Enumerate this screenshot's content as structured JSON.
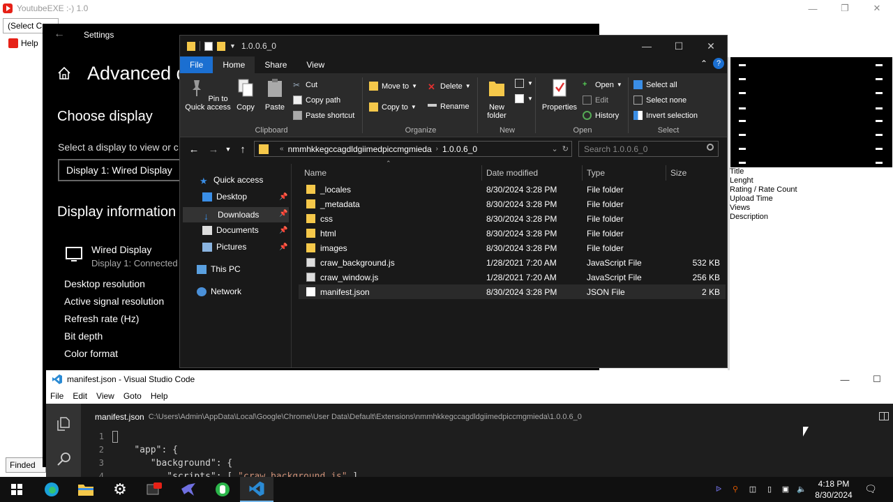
{
  "background_app": {
    "title": "YoutubeEXE  :-)   1.0",
    "select_label": "(Select C",
    "help_label": "Help",
    "find_button": "Finded",
    "properties": [
      "Title",
      "Lenght",
      "Rating / Rate Count",
      "Upload Time",
      "Views",
      "Description"
    ]
  },
  "settings": {
    "window_title": "Settings",
    "page_title": "Advanced d",
    "choose_display_heading": "Choose display",
    "select_prompt": "Select a display to view or c",
    "display_select_value": "Display 1: Wired Display",
    "display_info_heading": "Display information",
    "display_name": "Wired Display",
    "display_sub": "Display 1: Connected t",
    "info_items": [
      "Desktop resolution",
      "Active signal resolution",
      "Refresh rate (Hz)",
      "Bit depth",
      "Color format"
    ]
  },
  "explorer": {
    "title": "1.0.0.6_0",
    "tabs": {
      "file": "File",
      "home": "Home",
      "share": "Share",
      "view": "View"
    },
    "ribbon": {
      "pin_label": "Pin to Quick access",
      "copy": "Copy",
      "paste": "Paste",
      "cut": "Cut",
      "copy_path": "Copy path",
      "paste_shortcut": "Paste shortcut",
      "clipboard_group": "Clipboard",
      "move_to": "Move to",
      "copy_to": "Copy to",
      "delete": "Delete",
      "rename": "Rename",
      "organize_group": "Organize",
      "new_folder": "New folder",
      "new_group": "New",
      "properties": "Properties",
      "open": "Open",
      "edit": "Edit",
      "history": "History",
      "open_group": "Open",
      "select_all": "Select all",
      "select_none": "Select none",
      "invert_selection": "Invert selection",
      "select_group": "Select"
    },
    "path_segments": [
      "nmmhkkegccagdldgiimedpiccmgmieda",
      "1.0.0.6_0"
    ],
    "search_placeholder": "Search 1.0.0.6_0",
    "nav": {
      "quick_access": "Quick access",
      "desktop": "Desktop",
      "downloads": "Downloads",
      "documents": "Documents",
      "pictures": "Pictures",
      "this_pc": "This PC",
      "network": "Network"
    },
    "columns": {
      "name": "Name",
      "date": "Date modified",
      "type": "Type",
      "size": "Size"
    },
    "files": [
      {
        "name": "_locales",
        "date": "8/30/2024 3:28 PM",
        "type": "File folder",
        "size": "",
        "kind": "folder"
      },
      {
        "name": "_metadata",
        "date": "8/30/2024 3:28 PM",
        "type": "File folder",
        "size": "",
        "kind": "folder"
      },
      {
        "name": "css",
        "date": "8/30/2024 3:28 PM",
        "type": "File folder",
        "size": "",
        "kind": "folder"
      },
      {
        "name": "html",
        "date": "8/30/2024 3:28 PM",
        "type": "File folder",
        "size": "",
        "kind": "folder"
      },
      {
        "name": "images",
        "date": "8/30/2024 3:28 PM",
        "type": "File folder",
        "size": "",
        "kind": "folder"
      },
      {
        "name": "craw_background.js",
        "date": "1/28/2021 7:20 AM",
        "type": "JavaScript File",
        "size": "532 KB",
        "kind": "js"
      },
      {
        "name": "craw_window.js",
        "date": "1/28/2021 7:20 AM",
        "type": "JavaScript File",
        "size": "256 KB",
        "kind": "js"
      },
      {
        "name": "manifest.json",
        "date": "8/30/2024 3:28 PM",
        "type": "JSON File",
        "size": "2 KB",
        "kind": "json"
      }
    ]
  },
  "vscode": {
    "title": "manifest.json - Visual Studio Code",
    "menu": [
      "File",
      "Edit",
      "View",
      "Goto",
      "Help"
    ],
    "file_name": "manifest.json",
    "file_path": "C:\\Users\\Admin\\AppData\\Local\\Google\\Chrome\\User Data\\Default\\Extensions\\nmmhkkegccagdldgiimedpiccmgmieda\\1.0.0.6_0",
    "line_numbers": [
      "1",
      "2",
      "3",
      "4"
    ],
    "line2_key": "\"app\"",
    "line3_key": "\"background\"",
    "line4_key": "\"scripts\"",
    "line4_value": "\"craw_background.js\""
  },
  "taskbar": {
    "time": "4:18 PM",
    "date": "8/30/2024"
  },
  "colors": {
    "explorer_accent": "#1b6fd1",
    "folder": "#f5c84a",
    "taskbar_active": "#76b9ed"
  }
}
